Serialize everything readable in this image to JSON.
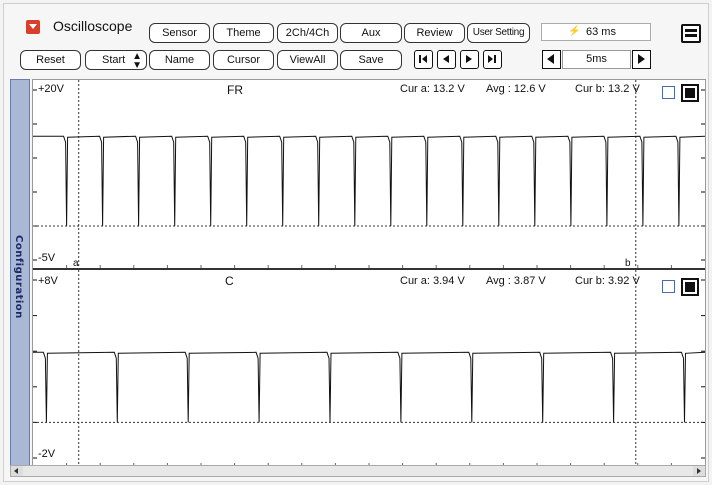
{
  "app": {
    "title": "Oscilloscope",
    "colors": {
      "accent": "#d8402b",
      "sidetab": "#a9b8d4",
      "trace": "#111111"
    }
  },
  "toolbar_top": {
    "buttons": [
      "Sensor",
      "Theme",
      "2Ch/4Ch",
      "Aux",
      "Review",
      "User Setting"
    ],
    "time_icon": "bolt-icon",
    "time_value": "63 ms"
  },
  "toolbar_bottom": {
    "buttons": [
      "Reset",
      "Start",
      "Name",
      "Cursor",
      "ViewAll",
      "Save"
    ],
    "start_spinner_icon": "spinner-icon",
    "nav_icons": [
      "first-icon",
      "prev-icon",
      "next-icon",
      "last-icon"
    ],
    "timebase": "5ms"
  },
  "sidetab": {
    "label": "Configuration"
  },
  "channels": [
    {
      "name": "FR",
      "scale_top": "+20V",
      "scale_bottom": "-5V",
      "ymax": 20,
      "ymin": -5,
      "cursor_a_label": "a",
      "cursor_b_label": "b",
      "cur_a": "Cur a: 13.2 V",
      "avg": "Avg  : 12.6 V",
      "cur_b": "Cur b: 13.2 V",
      "high_level": 13.2,
      "low_level": 0.0,
      "pulse_count": 19,
      "pulse_period_fraction": 0.0536,
      "pulse_first_fraction": 0.05
    },
    {
      "name": "C",
      "scale_top": "+8V",
      "scale_bottom": "-2V",
      "ymax": 8,
      "ymin": -2,
      "cur_a": "Cur a: 3.94 V",
      "avg": "Avg  : 3.87 V",
      "cur_b": "Cur b: 3.92 V",
      "high_level": 3.94,
      "low_level": 0.0,
      "pulse_count": 10,
      "pulse_period_fraction": 0.1055,
      "pulse_first_fraction": 0.02
    }
  ],
  "cursors": {
    "a_fraction": 0.068,
    "b_fraction": 0.897
  }
}
